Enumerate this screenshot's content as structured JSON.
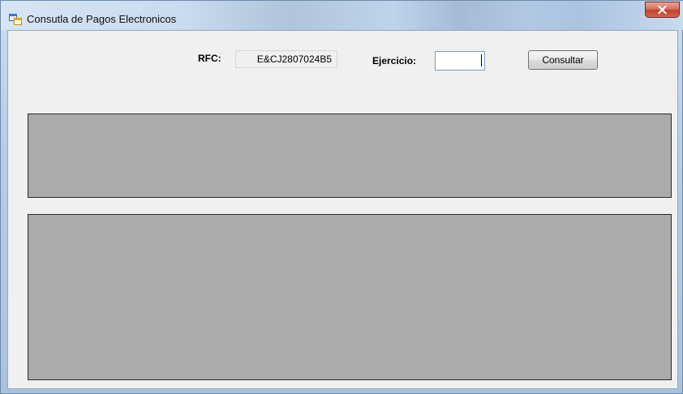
{
  "window": {
    "title": "Consutla de Pagos Electronicos"
  },
  "form": {
    "rfc_label": "RFC:",
    "rfc_value": "E&CJ2807024B5",
    "ejercicio_label": "Ejercicio:",
    "ejercicio_value": "",
    "consultar_label": "Consultar"
  },
  "colors": {
    "client_background": "#f0f0f0",
    "grid_background": "#ababab",
    "close_button": "#c0422a"
  },
  "icons": {
    "app": "app-window-icon",
    "close": "close-icon"
  }
}
